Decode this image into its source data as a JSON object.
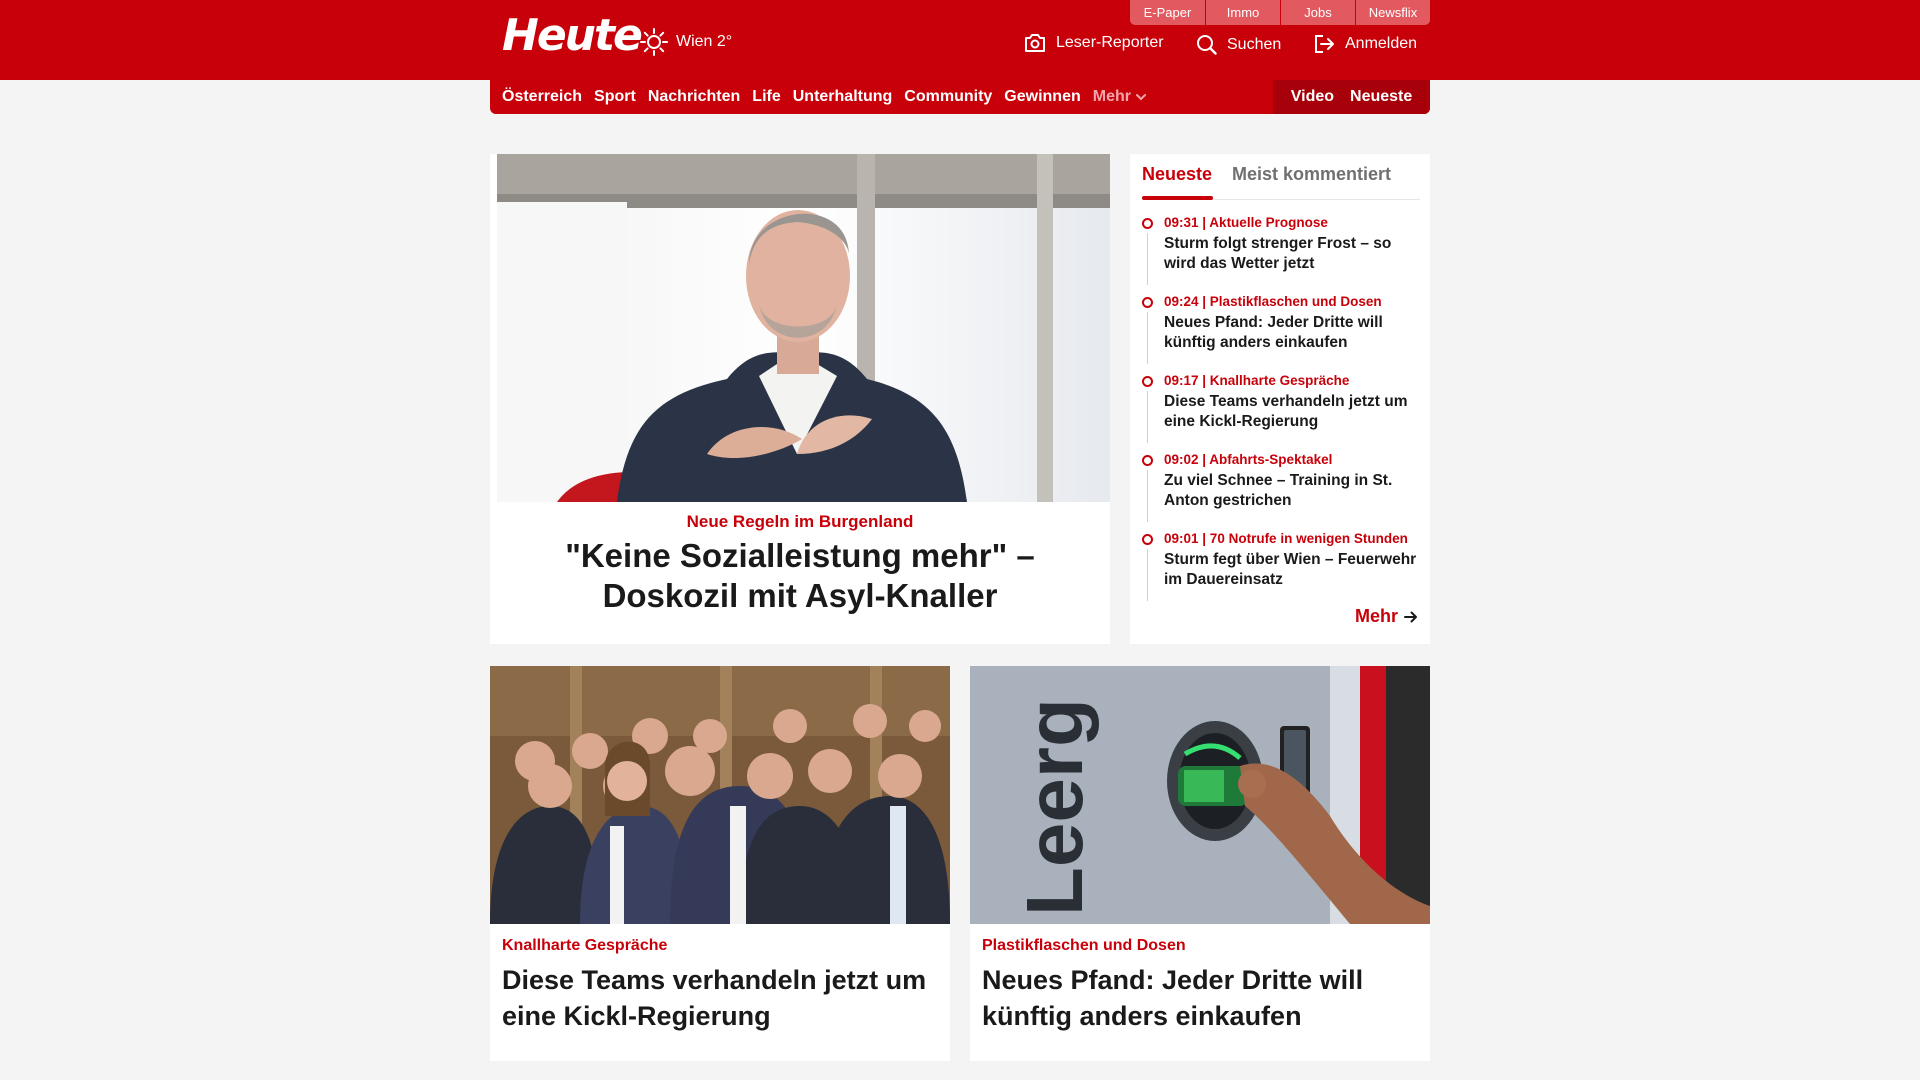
{
  "header": {
    "logo": "Heute",
    "weather": "Wien 2°",
    "top_links": [
      "E-Paper",
      "Immo",
      "Jobs",
      "Newsflix"
    ],
    "reporter": "Leser-Reporter",
    "search": "Suchen",
    "login": "Anmelden"
  },
  "nav": {
    "items": [
      "Österreich",
      "Sport",
      "Nachrichten",
      "Life",
      "Unterhaltung",
      "Community",
      "Gewinnen"
    ],
    "more": "Mehr",
    "video": "Video",
    "latest": "Neueste"
  },
  "hero": {
    "kicker": "Neue Regeln im Burgenland",
    "title": "\"Keine Sozialleistung mehr\" – Doskozil mit Asyl-Knaller"
  },
  "sidebar": {
    "tab_active": "Neueste",
    "tab_other": "Meist kommentiert",
    "items": [
      {
        "meta": "09:31 | Aktuelle Prognose",
        "title": "Sturm folgt strenger Frost – so wird das Wetter jetzt"
      },
      {
        "meta": "09:24 | Plastikflaschen und Dosen",
        "title": "Neues Pfand: Jeder Dritte will künftig anders einkaufen"
      },
      {
        "meta": "09:17 | Knallharte Gespräche",
        "title": "Diese Teams verhandeln jetzt um eine Kickl-Regierung"
      },
      {
        "meta": "09:02 | Abfahrts-Spektakel",
        "title": "Zu viel Schnee – Training in St. Anton gestrichen"
      },
      {
        "meta": "09:01 | 70 Notrufe in wenigen Stunden",
        "title": "Sturm fegt über Wien – Feuerwehr im Dauereinsatz"
      }
    ],
    "more": "Mehr"
  },
  "cards": [
    {
      "kicker": "Knallharte Gespräche",
      "title": "Diese Teams verhandeln jetzt um eine Kickl-Regierung"
    },
    {
      "kicker": "Plastikflaschen und Dosen",
      "title": "Neues Pfand: Jeder Dritte will künftig anders einkaufen",
      "image_text": "Leerg"
    }
  ],
  "colors": {
    "brand": "#c8000a",
    "background": "#f4f4f4"
  },
  "icons": [
    "sun-icon",
    "camera-icon",
    "search-icon",
    "login-icon",
    "chevron-down-icon",
    "arrow-right-icon"
  ]
}
